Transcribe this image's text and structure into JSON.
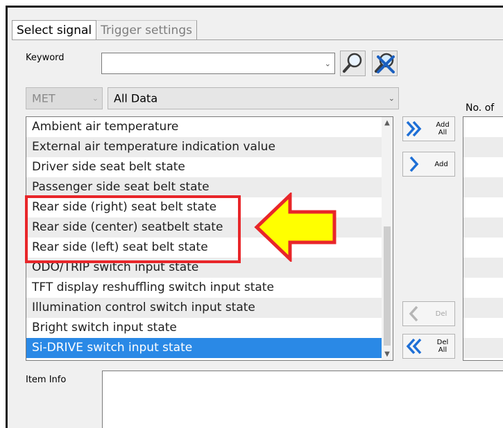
{
  "tabs": [
    {
      "label": "Select signal",
      "active": true
    },
    {
      "label": "Trigger settings",
      "active": false
    }
  ],
  "keyword": {
    "label": "Keyword",
    "value": "",
    "placeholder": ""
  },
  "filters": {
    "system": "MET",
    "category": "All Data"
  },
  "signals": [
    {
      "label": "Ambient air temperature",
      "selected": false
    },
    {
      "label": "External air temperature indication value",
      "selected": false
    },
    {
      "label": "Driver side seat belt state",
      "selected": false
    },
    {
      "label": "Passenger side seat belt state",
      "selected": false
    },
    {
      "label": "Rear side (right) seat belt state",
      "selected": false
    },
    {
      "label": "Rear side (center) seatbelt state",
      "selected": false
    },
    {
      "label": "Rear side (left) seat belt state",
      "selected": false
    },
    {
      "label": "ODO/TRIP switch input state",
      "selected": false
    },
    {
      "label": "TFT display reshuffling switch input state",
      "selected": false
    },
    {
      "label": "Illumination control switch input state",
      "selected": false
    },
    {
      "label": "Bright switch input state",
      "selected": false
    },
    {
      "label": "Si-DRIVE switch input state",
      "selected": true
    }
  ],
  "buttons": {
    "add_all": "Add All",
    "add": "Add",
    "del": "Del",
    "del_all": "Del All"
  },
  "selected_panel": {
    "header": "No. of"
  },
  "item_info": {
    "label": "Item Info",
    "value": ""
  },
  "colors": {
    "highlight": "#e8262a",
    "arrow_fill": "#ffff00",
    "selection": "#2a89e6"
  }
}
